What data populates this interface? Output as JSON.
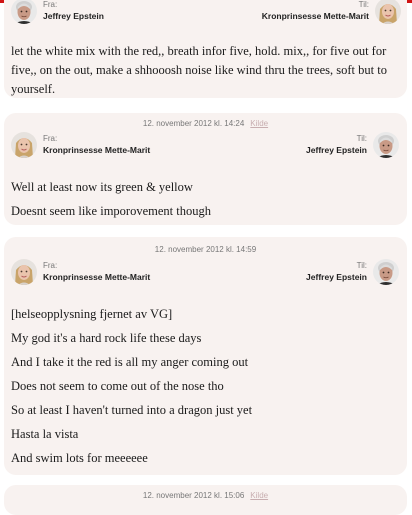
{
  "labels": {
    "from": "Fra:",
    "to": "Til:",
    "source": "Kilde"
  },
  "people": {
    "jeffrey": "Jeffrey Epstein",
    "mette": "Kronprinsesse Mette-Marit"
  },
  "messages": [
    {
      "timestamp": "",
      "from": "Jeffrey Epstein",
      "to": "Kronprinsesse Mette-Marit",
      "lines": [
        "let the white mix with the red,, breath infor five, hold. mix,, for five out for five,, on the out, make a shhooosh noise like wind thru the trees, soft but to yourself."
      ]
    },
    {
      "timestamp": "12. november 2012 kl. 14:24",
      "from": "Kronprinsesse Mette-Marit",
      "to": "Jeffrey Epstein",
      "lines": [
        "Well at least now its green & yellow",
        "Doesnt seem like imporovement though"
      ]
    },
    {
      "timestamp": "12. november 2012 kl. 14:59",
      "from": "Kronprinsesse Mette-Marit",
      "to": "Jeffrey Epstein",
      "lines": [
        "[helseopplysning fjernet av VG]",
        "My god it's a hard rock life these days",
        "And I take it the red is all my anger coming out",
        "Does not seem to come out of the nose tho",
        "So at least I haven't turned into a dragon just yet",
        "Hasta la vista",
        "And swim lots for meeeeee"
      ]
    },
    {
      "timestamp": "12. november 2012 kl. 15:06",
      "from": "",
      "to": "",
      "lines": []
    }
  ],
  "colors": {
    "accent_bar": "#d01414",
    "card_bg": "#f8f2f0",
    "source_link": "#c8aeb0"
  }
}
